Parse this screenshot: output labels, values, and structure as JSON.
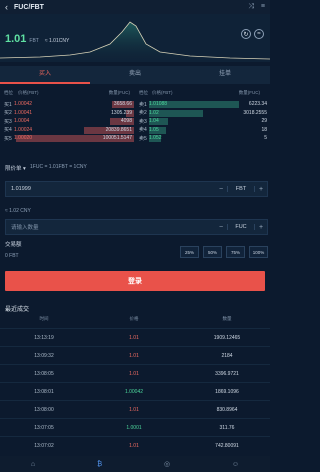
{
  "header": {
    "back": "‹",
    "title": "FUC/FBT",
    "icon_a": "⤨",
    "icon_b": "≡"
  },
  "ticker": {
    "price": "1.01",
    "unit": "FBT",
    "cny": "≈ 1.01CNY",
    "btn_a": "↻",
    "btn_b": "≈"
  },
  "tabs": [
    {
      "label": "买入"
    },
    {
      "label": "卖出"
    },
    {
      "label": "挂单"
    }
  ],
  "book": {
    "buy_head": {
      "level": "档位",
      "price": "价格(FBT)",
      "qty": "数量(FUC)"
    },
    "sell_head": {
      "level": "档位",
      "price": "价格(FBT)",
      "qty": "数量(FUC)"
    },
    "buys": [
      {
        "level": "买1",
        "price": "1.00042",
        "qty": "3658.66",
        "depth": 0.18
      },
      {
        "level": "买2",
        "price": "1.00041",
        "qty": "1305.239",
        "depth": 0.07
      },
      {
        "level": "买3",
        "price": "1.0004",
        "qty": "4098",
        "depth": 0.2
      },
      {
        "level": "买4",
        "price": "1.00024",
        "qty": "20839.8651",
        "depth": 0.42
      },
      {
        "level": "买5",
        "price": "1.00020",
        "qty": "100051.5147",
        "depth": 0.98
      }
    ],
    "sells": [
      {
        "level": "卖1",
        "price": "1.01088",
        "qty": "6223.34",
        "depth": 0.75
      },
      {
        "level": "卖2",
        "price": "1.02",
        "qty": "3018.2555",
        "depth": 0.45
      },
      {
        "level": "卖3",
        "price": "1.04",
        "qty": "29",
        "depth": 0.16
      },
      {
        "level": "卖4",
        "price": "1.05",
        "qty": "18",
        "depth": 0.14
      },
      {
        "level": "卖5",
        "price": "1.052",
        "qty": "5",
        "depth": 0.1
      }
    ]
  },
  "order": {
    "type_label": "限价单 ▾",
    "rate": "1FUC = 1.01FBT = 1CNY",
    "price_value": "1.01999",
    "price_unit": "FBT",
    "minus": "−",
    "plus": "+",
    "price_cny": "≈ 1.02 CNY",
    "qty_placeholder": "请输入数量",
    "qty_unit": "FUC",
    "trade_amount_label": "交易额",
    "trade_amount_value": "0 FBT",
    "percents": [
      "25%",
      "50%",
      "75%",
      "100%"
    ],
    "submit": "登录"
  },
  "recent": {
    "title": "最近成交",
    "head": {
      "time": "时间",
      "price": "价格",
      "qty": "数量"
    },
    "rows": [
      {
        "time": "13:13:19",
        "price": "1.01",
        "qty": "1909.12465",
        "dir": "down"
      },
      {
        "time": "13:09:32",
        "price": "1.01",
        "qty": "2184",
        "dir": "down"
      },
      {
        "time": "13:08:05",
        "price": "1.01",
        "qty": "3396.9721",
        "dir": "down"
      },
      {
        "time": "13:08:01",
        "price": "1.00042",
        "qty": "1869.1096",
        "dir": "up"
      },
      {
        "time": "13:08:00",
        "price": "1.01",
        "qty": "830.8964",
        "dir": "down"
      },
      {
        "time": "13:07:05",
        "price": "1.0001",
        "qty": "311.76",
        "dir": "up"
      },
      {
        "time": "13:07:02",
        "price": "1.01",
        "qty": "742.80091",
        "dir": "down"
      }
    ]
  },
  "nav": {
    "home": "⌂",
    "trade": "₿",
    "assets": "◎",
    "me": "☺"
  },
  "colors": {
    "buy": "#ef6b62",
    "sell": "#4dd69c",
    "accent": "#e9524a",
    "bg": "#0c1a2e"
  }
}
